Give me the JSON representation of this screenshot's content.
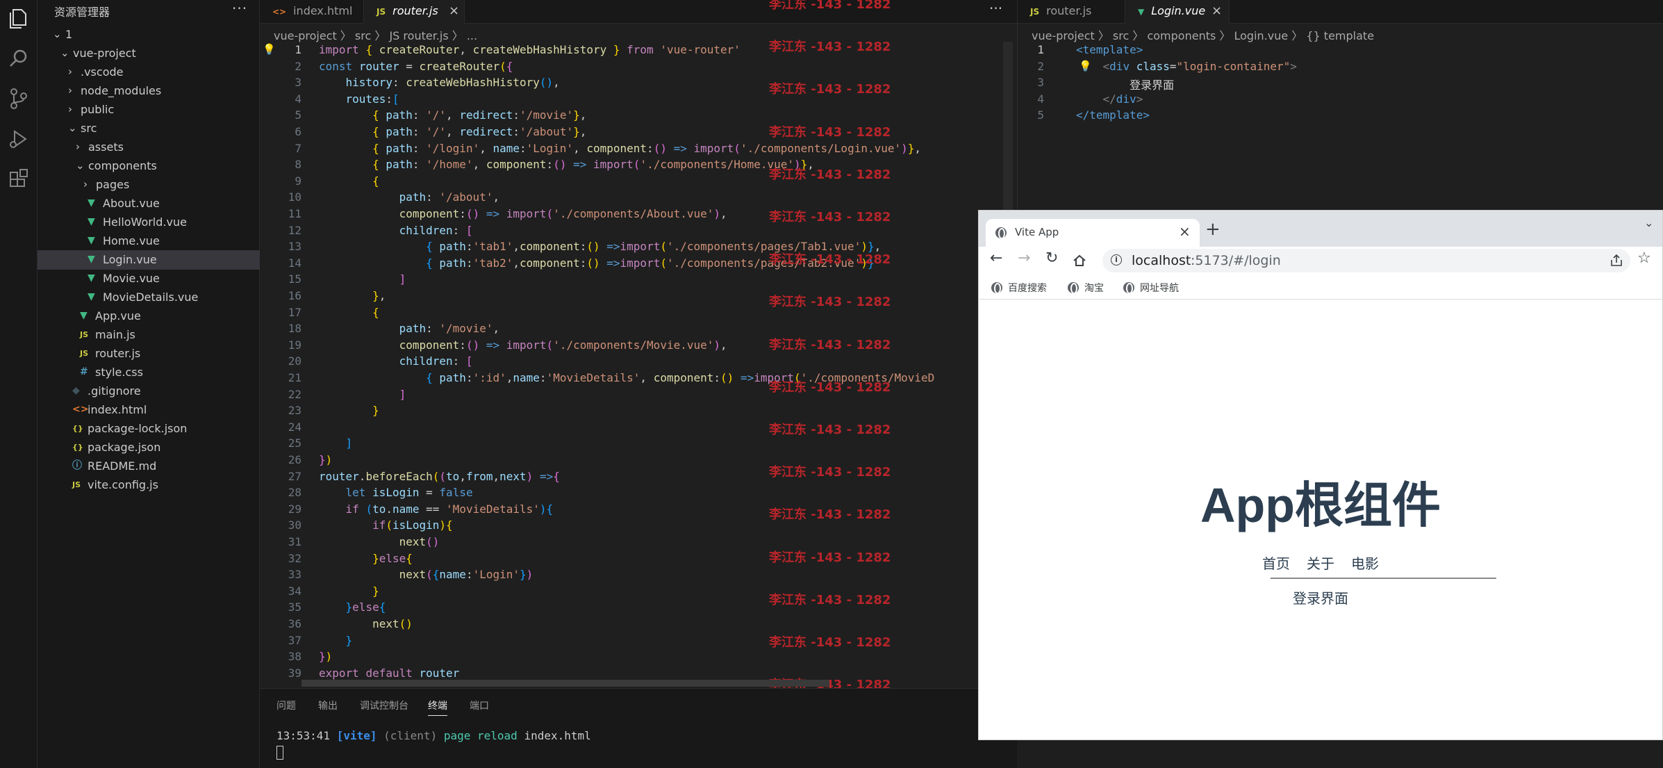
{
  "explorer": {
    "title": "资源管理器",
    "more": "···",
    "tree": [
      {
        "name": "1",
        "type": "folder-open",
        "depth": 0
      },
      {
        "name": "vue-project",
        "type": "folder-open",
        "depth": 1
      },
      {
        "name": ".vscode",
        "type": "folder",
        "depth": 2
      },
      {
        "name": "node_modules",
        "type": "folder",
        "depth": 2
      },
      {
        "name": "public",
        "type": "folder",
        "depth": 2
      },
      {
        "name": "src",
        "type": "folder-open",
        "depth": 2
      },
      {
        "name": "assets",
        "type": "folder",
        "depth": 3
      },
      {
        "name": "components",
        "type": "folder-open",
        "depth": 3
      },
      {
        "name": "pages",
        "type": "folder",
        "depth": 4
      },
      {
        "name": "About.vue",
        "type": "vue",
        "depth": 4
      },
      {
        "name": "HelloWorld.vue",
        "type": "vue",
        "depth": 4
      },
      {
        "name": "Home.vue",
        "type": "vue",
        "depth": 4
      },
      {
        "name": "Login.vue",
        "type": "vue",
        "depth": 4,
        "selected": true
      },
      {
        "name": "Movie.vue",
        "type": "vue",
        "depth": 4
      },
      {
        "name": "MovieDetails.vue",
        "type": "vue",
        "depth": 4
      },
      {
        "name": "App.vue",
        "type": "vue",
        "depth": 3
      },
      {
        "name": "main.js",
        "type": "js",
        "depth": 3
      },
      {
        "name": "router.js",
        "type": "js",
        "depth": 3
      },
      {
        "name": "style.css",
        "type": "css",
        "depth": 3
      },
      {
        "name": ".gitignore",
        "type": "git",
        "depth": 2
      },
      {
        "name": "index.html",
        "type": "html",
        "depth": 2
      },
      {
        "name": "package-lock.json",
        "type": "json",
        "depth": 2
      },
      {
        "name": "package.json",
        "type": "json",
        "depth": 2
      },
      {
        "name": "README.md",
        "type": "info",
        "depth": 2
      },
      {
        "name": "vite.config.js",
        "type": "js",
        "depth": 2
      }
    ]
  },
  "editor1": {
    "tabs": [
      {
        "label": "index.html",
        "icon": "<>",
        "active": false
      },
      {
        "label": "router.js",
        "icon": "JS",
        "active": true
      }
    ],
    "more": "···",
    "breadcrumb": "vue-project 〉 src 〉 JS router.js 〉 ...",
    "code": [
      "[k:import] [p1:{] [f:createRouter], [f:createWebHashHistory] [p1:}] [k:from] [s:'vue-router']",
      "[kb:const] [v:router] = [f:createRouter][p1:(][p2:{]",
      "    [v:history]: [f:createWebHashHistory][p3:()],",
      "    [v:routes]:[p3:[]",
      "        [p1:{] [v:path]: [s:'/'], [v:redirect]:[s:'/movie'][p1:}],",
      "        [p1:{] [v:path]: [s:'/'], [v:redirect]:[s:'/about'][p1:}],",
      "        [p1:{] [v:path]: [s:'/login'], [v:name]:[s:'Login'], [f:component]:[p2:()] [kb:=>] [k:import][p2:(][s:'./components/Login.vue'][p2:)][p1:}],",
      "        [p1:{] [v:path]: [s:'/home'], [f:component]:[p2:()] [kb:=>] [k:import][p2:(][s:'./components/Home.vue'][p2:)][p1:}],",
      "        [p1:{]",
      "            [v:path]: [s:'/about'],",
      "            [f:component]:[p2:()] [kb:=>] [k:import][p2:(][s:'./components/About.vue'][p2:)],",
      "            [v:children]: [p2:[]",
      "                [p3:{] [v:path]:[s:'tab1'],[f:component]:[p1:()] [kb:=>][k:import][p1:(][s:'./components/pages/Tab1.vue'][p1:)][p3:}],",
      "                [p3:{] [v:path]:[s:'tab2'],[f:component]:[p1:()] [kb:=>][k:import][p1:(][s:'./components/pages/Tab2.vue'][p1:)][p3:}]",
      "            [p2:]]",
      "        [p1:}],",
      "        [p1:{]",
      "            [v:path]: [s:'/movie'],",
      "            [f:component]:[p2:()] [kb:=>] [k:import][p2:(][s:'./components/Movie.vue'][p2:)],",
      "            [v:children]: [p2:[]",
      "                [p3:{] [v:path]:[s:':id'],[v:name]:[s:'MovieDetails'], [f:component]:[p1:()] [kb:=>][k:import][p1:(][s:'./components/MovieD]",
      "            [p2:]]",
      "        [p1:}]",
      "",
      "    [p3:]]",
      "[p2:}][p1:)]",
      "[v:router].[f:beforeEach][p1:(][p2:(][v:to],[v:from],[v:next][p2:)] [kb:=>][p2:{]",
      "    [kb:let] [v:isLogin] = [kb:false]",
      "    [k:if] [p3:(][v:to].[v:name] == [s:'MovieDetails'][p3:)][p3:{]",
      "        [k:if][p1:(][v:isLogin][p1:)][p1:{]",
      "            [f:next][p2:()]",
      "        [p1:}][k:else][p1:{]",
      "            [f:next][p2:(][p3:{][v:name]:[s:'Login'][p3:}][p2:)]",
      "        [p1:}]",
      "    [p3:}][k:else][p3:{]",
      "        [f:next][p1:()]",
      "    [p3:}]",
      "[p2:}][p1:)]",
      "[k:export] [k:default] [v:router]"
    ],
    "watermark": "李江东 -143 - 1282"
  },
  "panel": {
    "tabs": [
      "问题",
      "输出",
      "调试控制台",
      "终端",
      "端口"
    ],
    "active_tab": "终端",
    "log_time": "13:53:41",
    "log_tag": "[vite]",
    "log_client": "(client)",
    "log_msg": "page reload",
    "log_file": "index.html"
  },
  "editor2": {
    "tabs": [
      {
        "label": "router.js",
        "icon": "JS",
        "active": false
      },
      {
        "label": "Login.vue",
        "icon": "V",
        "active": true
      }
    ],
    "breadcrumb": "vue-project 〉 src 〉 components 〉 Login.vue 〉 {} template",
    "code": [
      "[t:<template>]",
      "    [gr:<][t:div] [a:class]=[s:\"login-container\"][gr:>]",
      "        [pl:登录界面]",
      "    [gr:</][t:div][gr:>]",
      "[t:</template>]"
    ]
  },
  "browser": {
    "tab_title": "Vite App",
    "new_tab": "+",
    "url_host": "localhost",
    "url_rest": ":5173/#/login",
    "bookmarks": [
      "百度搜索",
      "淘宝",
      "网址导航"
    ],
    "app_title": "App根组件",
    "nav_links": [
      "首页",
      "关于",
      "电影"
    ],
    "view_text": "登录界面"
  },
  "colors": {
    "vue": "#41b883",
    "js": "#cbcb41",
    "accent": "#0078d4",
    "watermark": "#b8252a"
  }
}
